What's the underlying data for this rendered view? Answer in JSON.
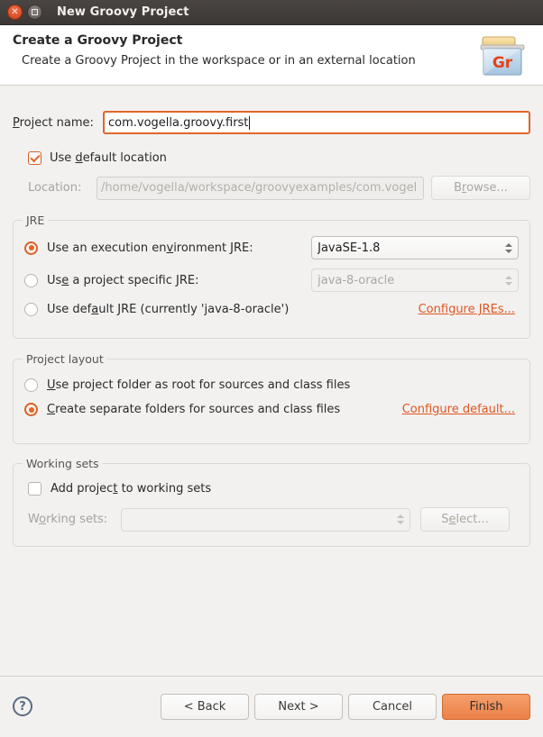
{
  "window": {
    "title": "New Groovy Project",
    "close_icon": "close-icon",
    "maximize_icon": "maximize-icon"
  },
  "header": {
    "title": "Create a Groovy Project",
    "subtitle": "Create a Groovy Project in the workspace or in an external location",
    "icon_label": "Gr",
    "icon_name": "groovy-project-folder-icon"
  },
  "project_name": {
    "label": "Project name:",
    "label_mnemonic": "P",
    "label_rest": "roject name:",
    "value": "com.vogella.groovy.first",
    "focused": true
  },
  "default_location": {
    "checkbox_label_pre": "Use ",
    "checkbox_label_mnemonic": "d",
    "checkbox_label_post": "efault location",
    "checked": true
  },
  "location": {
    "label": "Location:",
    "value": "/home/vogella/workspace/groovyexamples/com.vogel",
    "disabled": true,
    "browse_pre": "B",
    "browse_mnemonic": "r",
    "browse_post": "owse...",
    "browse_label": "Browse..."
  },
  "jre": {
    "group_title": "JRE",
    "options": [
      {
        "label_pre": "Use an execution en",
        "label_mnemonic": "v",
        "label_post": "ironment JRE:",
        "label": "Use an execution environment JRE:",
        "selected": true,
        "combo_value": "JavaSE-1.8",
        "combo_disabled": false
      },
      {
        "label_pre": "Us",
        "label_mnemonic": "e",
        "label_post": " a project specific JRE:",
        "label": "Use a project specific JRE:",
        "selected": false,
        "combo_value": "java-8-oracle",
        "combo_disabled": true
      },
      {
        "label_pre": "Use def",
        "label_mnemonic": "a",
        "label_post": "ult JRE (currently 'java-8-oracle')",
        "label": "Use default JRE (currently 'java-8-oracle')",
        "selected": false
      }
    ],
    "configure_link": "Configure JREs..."
  },
  "project_layout": {
    "group_title": "Project layout",
    "options": [
      {
        "label_mnemonic": "U",
        "label_rest": "se project folder as root for sources and class files",
        "label": "Use project folder as root for sources and class files",
        "selected": false
      },
      {
        "label_mnemonic": "C",
        "label_rest": "reate separate folders for sources and class files",
        "label": "Create separate folders for sources and class files",
        "selected": true
      }
    ],
    "configure_link": "Configure default..."
  },
  "working_sets": {
    "group_title": "Working sets",
    "checkbox_label_pre": "Add projec",
    "checkbox_label_mnemonic": "t",
    "checkbox_label_post": " to working sets",
    "checkbox_label": "Add project to working sets",
    "checked": false,
    "field_label_pre": "W",
    "field_label_mnemonic": "o",
    "field_label_post": "rking sets:",
    "field_label": "Working sets:",
    "field_value": "",
    "select_pre": "S",
    "select_mnemonic": "e",
    "select_post": "lect...",
    "select_label": "Select..."
  },
  "footer": {
    "help_glyph": "?",
    "buttons": [
      {
        "label": "< Back",
        "primary": false
      },
      {
        "label": "Next >",
        "primary": false
      },
      {
        "label": "Cancel",
        "primary": false
      },
      {
        "label": "Finish",
        "primary": true
      }
    ]
  },
  "colors": {
    "accent": "#e1662a",
    "link": "#e1561f",
    "titlebar": "#3c3835",
    "body_bg": "#f2f1f0",
    "finish_button": "#ed8048"
  }
}
